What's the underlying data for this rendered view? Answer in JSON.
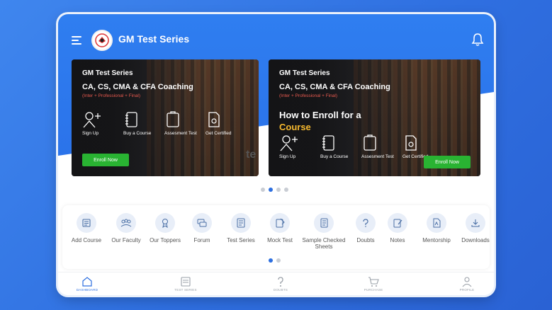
{
  "header": {
    "title": "GM Test Series"
  },
  "banners": [
    {
      "brand": "GM Test Series",
      "title": "CA, CS, CMA & CFA Coaching",
      "subtitle": "(Inter + Professional + Final)",
      "steps": [
        "Sign Up",
        "Buy a Course",
        "Assesment Test",
        "Get Certified"
      ],
      "button": "Enroll Now"
    },
    {
      "brand": "GM Test Series",
      "title": "CA, CS, CMA & CFA Coaching",
      "subtitle": "(Inter + Professional + Final)",
      "headline": "How to Enroll for a",
      "headline_highlight": "Course",
      "steps": [
        "Sign Up",
        "Buy a Course",
        "Assesment Test",
        "Get Certified"
      ],
      "button": "Enroll Now"
    }
  ],
  "ghost_text": "te",
  "carousel": {
    "count": 4,
    "active": 1
  },
  "shortcuts": [
    {
      "label": "Add Course",
      "icon": "add-course-icon"
    },
    {
      "label": "Our Faculty",
      "icon": "faculty-icon"
    },
    {
      "label": "Our Toppers",
      "icon": "toppers-icon"
    },
    {
      "label": "Forum",
      "icon": "forum-icon"
    },
    {
      "label": "Test Series",
      "icon": "test-series-icon"
    },
    {
      "label": "Mock Test",
      "icon": "mock-test-icon"
    },
    {
      "label": "Sample Checked Sheets",
      "icon": "sample-sheets-icon"
    },
    {
      "label": "Doubts",
      "icon": "doubts-icon"
    },
    {
      "label": "Notes",
      "icon": "notes-icon"
    },
    {
      "label": "Mentorship",
      "icon": "mentorship-icon"
    },
    {
      "label": "Downloads",
      "icon": "downloads-icon"
    }
  ],
  "shortcut_pager": {
    "count": 2,
    "active": 0
  },
  "bottom_nav": [
    {
      "label": "DASHBOARD",
      "icon": "home-icon",
      "active": true
    },
    {
      "label": "TEST SERIES",
      "icon": "test-series-icon",
      "active": false
    },
    {
      "label": "DOUBTS",
      "icon": "question-icon",
      "active": false
    },
    {
      "label": "PURCHASE",
      "icon": "cart-icon",
      "active": false
    },
    {
      "label": "PROFILE",
      "icon": "profile-icon",
      "active": false
    }
  ],
  "colors": {
    "primary": "#2f7ef0",
    "enroll_green": "#29b332",
    "accent_yellow": "#f5b82e",
    "subtitle_red": "#e85a4f",
    "nav_active": "#2d6fe0"
  }
}
